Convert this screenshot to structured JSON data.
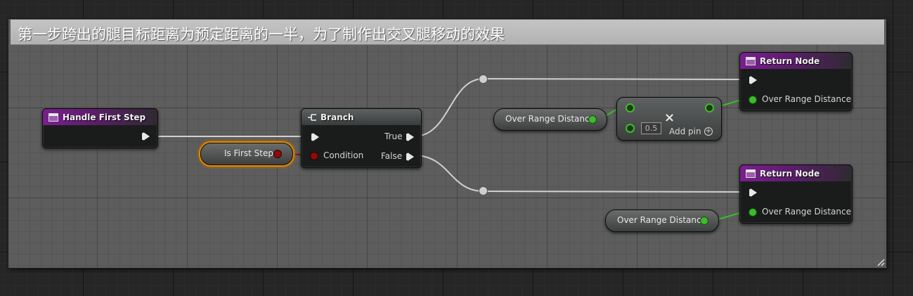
{
  "comment": {
    "text": "第一步跨出的腿目标距离为预定距离的一半，为了制作出交叉腿移动的效果"
  },
  "nodes": {
    "handle_first_step": {
      "title": "Handle First Step"
    },
    "is_first_step": {
      "label": "Is First Step"
    },
    "branch": {
      "title": "Branch",
      "condition_label": "Condition",
      "true_label": "True",
      "false_label": "False"
    },
    "over_range_distance_1": {
      "label": "Over Range Distance"
    },
    "multiply": {
      "operator": "×",
      "value": "0.5",
      "add_pin_label": "Add pin",
      "add_pin_symbol": "+"
    },
    "return_node_1": {
      "title": "Return Node",
      "pin_label": "Over Range Distance"
    },
    "over_range_distance_2": {
      "label": "Over Range Distance"
    },
    "return_node_2": {
      "title": "Return Node",
      "pin_label": "Over Range Distance"
    }
  },
  "colors": {
    "function_header": "#7a1f8f",
    "float_pin": "#3dbb2b",
    "bool_pin": "#8a0c0c",
    "exec_wire": "#d0d0d0",
    "selection": "#e08a00"
  }
}
